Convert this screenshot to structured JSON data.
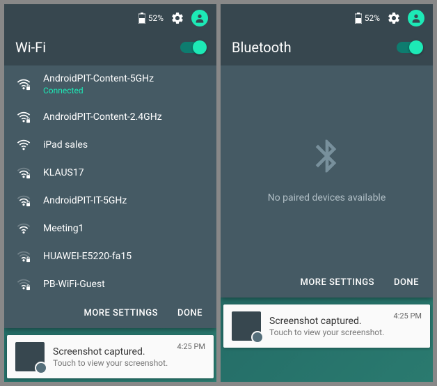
{
  "left": {
    "status": {
      "battery": "52%"
    },
    "title": "Wi-Fi",
    "toggle_on": true,
    "networks": [
      {
        "name": "AndroidPIT-Content-5GHz",
        "sub": "Connected",
        "strength": 3,
        "locked": true
      },
      {
        "name": "AndroidPIT-Content-2.4GHz",
        "strength": 3,
        "locked": true
      },
      {
        "name": "iPad sales",
        "strength": 3,
        "locked": false
      },
      {
        "name": "KLAUS17",
        "strength": 2,
        "locked": true
      },
      {
        "name": "AndroidPIT-IT-5GHz",
        "strength": 2,
        "locked": true
      },
      {
        "name": "Meeting1",
        "strength": 2,
        "locked": false
      },
      {
        "name": "HUAWEI-E5220-fa15",
        "strength": 1,
        "locked": true
      },
      {
        "name": "PB-WiFi-Guest",
        "strength": 1,
        "locked": true
      }
    ],
    "footer": {
      "more": "MORE SETTINGS",
      "done": "DONE"
    },
    "notification": {
      "title": "Screenshot captured.",
      "sub": "Touch to view your screenshot.",
      "time": "4:25 PM"
    }
  },
  "right": {
    "status": {
      "battery": "52%"
    },
    "title": "Bluetooth",
    "toggle_on": true,
    "empty_text": "No paired devices available",
    "footer": {
      "more": "MORE SETTINGS",
      "done": "DONE"
    },
    "notification": {
      "title": "Screenshot captured.",
      "sub": "Touch to view your screenshot.",
      "time": "4:25 PM"
    }
  }
}
